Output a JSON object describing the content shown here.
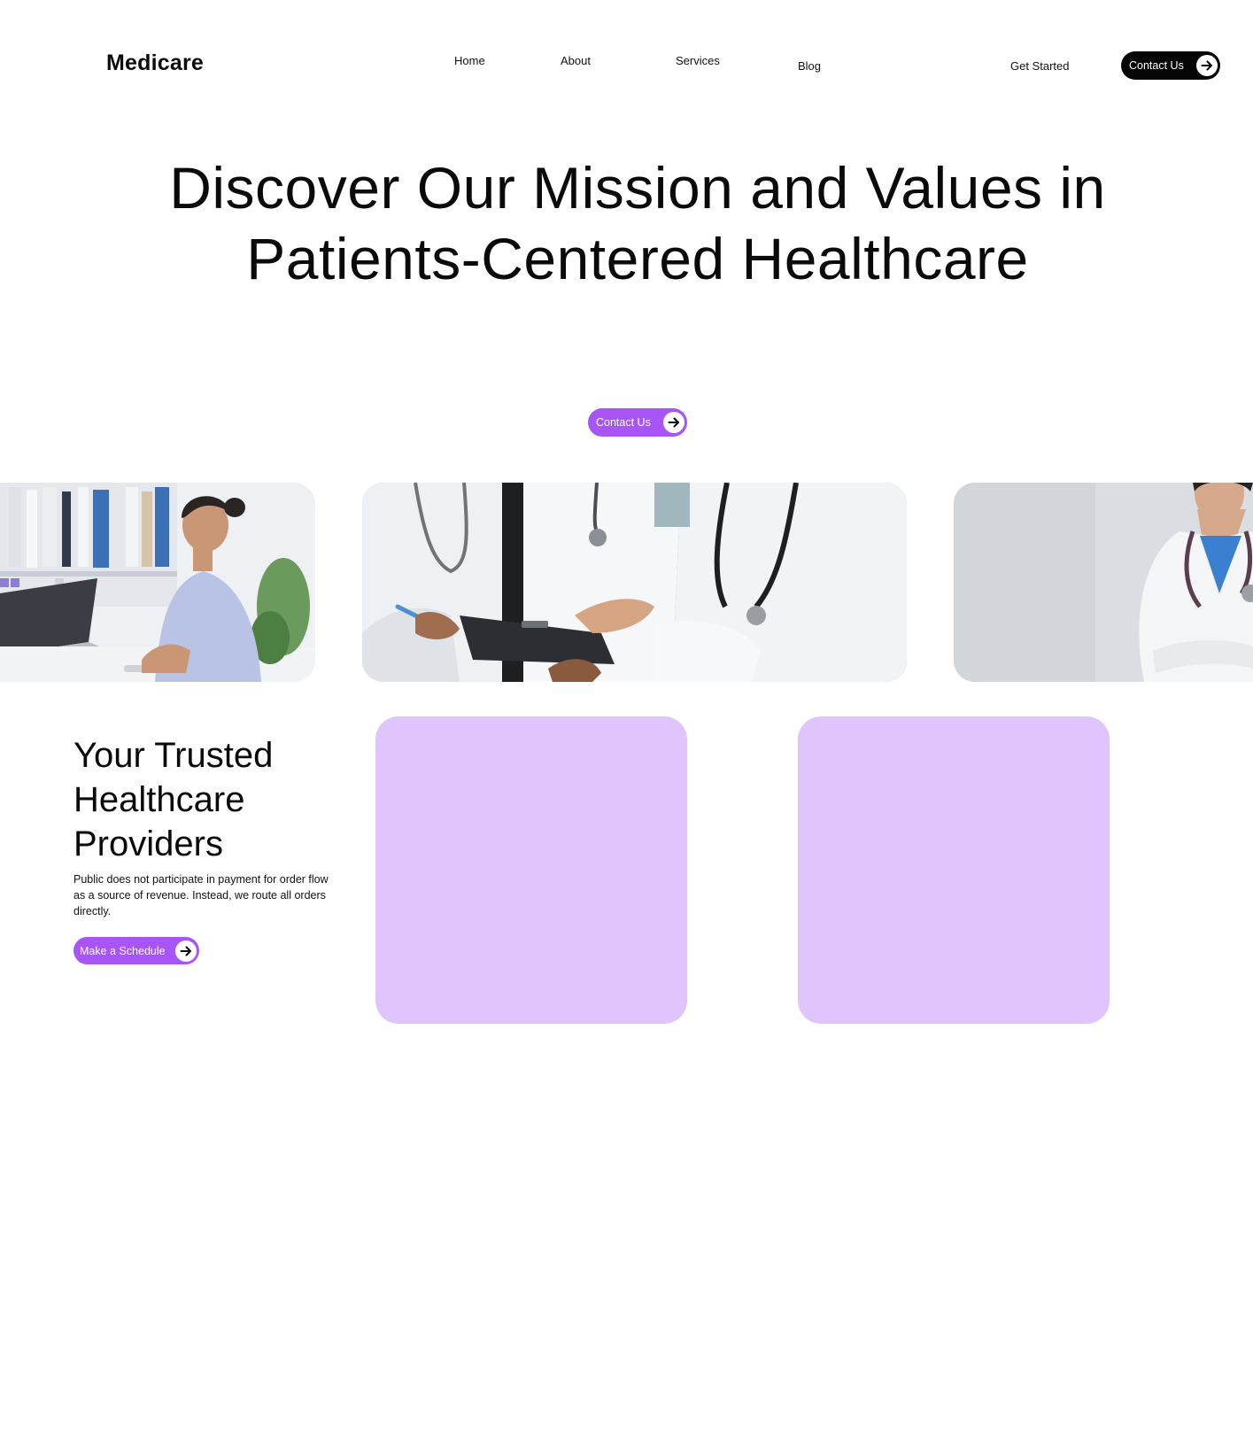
{
  "header": {
    "logo": "Medicare",
    "nav": {
      "home": "Home",
      "about": "About",
      "services": "Services",
      "blog": "Blog"
    },
    "get_started": "Get Started",
    "contact_label": "Contact Us"
  },
  "hero": {
    "title": "Discover Our Mission and Values in Patients-Centered Healthcare",
    "contact_label": "Contact Us"
  },
  "providers": {
    "title": "Your Trusted Healthcare Providers",
    "description": "Public does not participate in payment for order flow as a source of revenue. Instead, we route all orders directly.",
    "schedule_label": "Make a Schedule"
  },
  "colors": {
    "accent": "#a855f7",
    "card": "#e0c4fd",
    "dark": "#050505"
  },
  "icons": {
    "button_arrow": "arrow-right-icon"
  }
}
